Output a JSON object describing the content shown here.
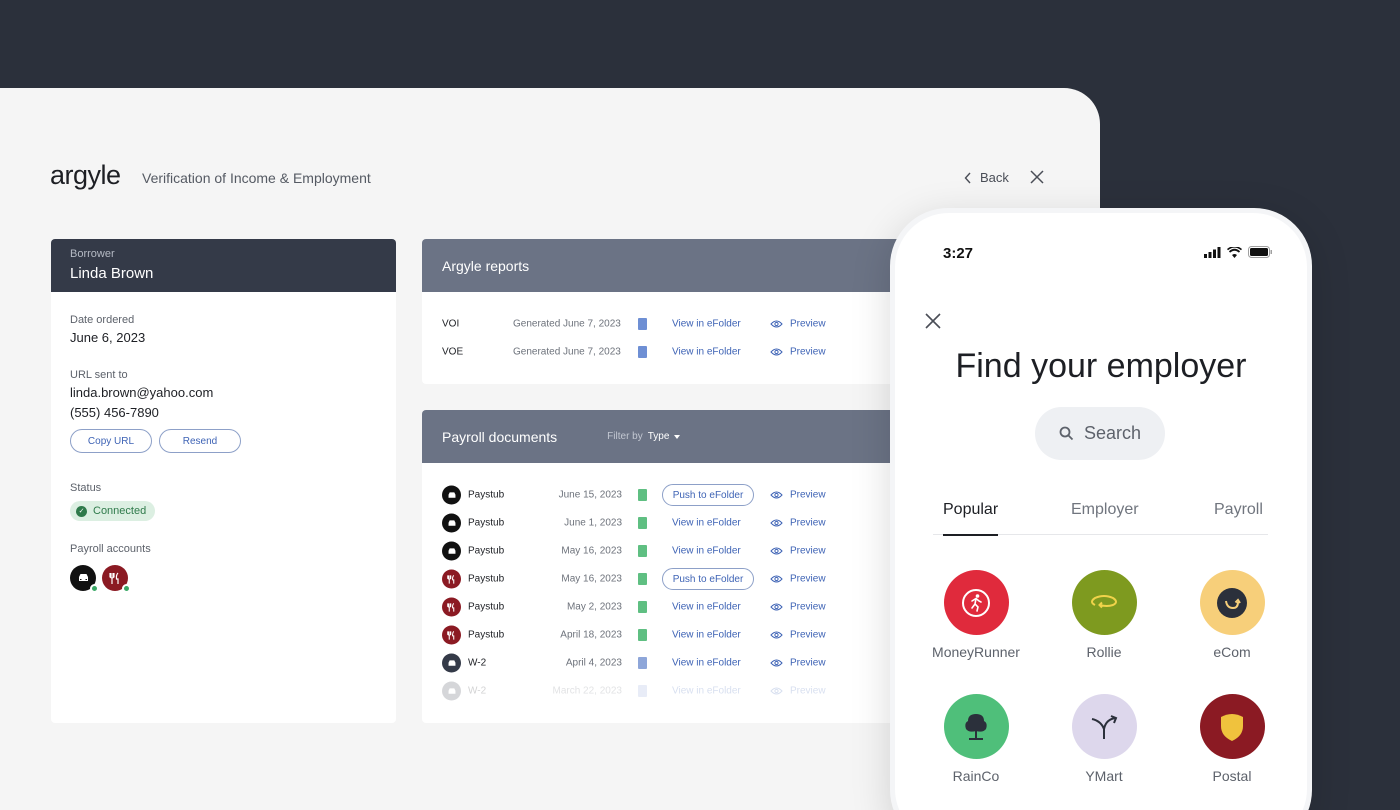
{
  "app": {
    "logo": "argyle",
    "title": "Verification of Income & Employment",
    "back_label": "Back"
  },
  "borrower": {
    "header_label": "Borrower",
    "name": "Linda Brown",
    "date_ordered_label": "Date ordered",
    "date_ordered": "June 6, 2023",
    "url_sent_label": "URL sent to",
    "email": "linda.brown@yahoo.com",
    "phone": "(555) 456-7890",
    "copy_url_label": "Copy URL",
    "resend_label": "Resend",
    "status_label": "Status",
    "status_value": "Connected",
    "payroll_accounts_label": "Payroll accounts"
  },
  "reports": {
    "title": "Argyle reports",
    "rows": [
      {
        "name": "VOI",
        "date": "Generated June 7, 2023",
        "link": "View in eFolder",
        "preview": "Preview"
      },
      {
        "name": "VOE",
        "date": "Generated June 7, 2023",
        "link": "View in eFolder",
        "preview": "Preview"
      }
    ]
  },
  "payroll": {
    "title": "Payroll documents",
    "filter_label": "Filter by",
    "filter_value": "Type",
    "rows": [
      {
        "name": "Paystub",
        "date": "June 15, 2023",
        "action": "Push to eFolder",
        "preview": "Preview"
      },
      {
        "name": "Paystub",
        "date": "June 1, 2023",
        "action": "View in eFolder",
        "preview": "Preview"
      },
      {
        "name": "Paystub",
        "date": "May 16, 2023",
        "action": "View in eFolder",
        "preview": "Preview"
      },
      {
        "name": "Paystub",
        "date": "May 16, 2023",
        "action": "Push to eFolder",
        "preview": "Preview"
      },
      {
        "name": "Paystub",
        "date": "May 2, 2023",
        "action": "View in eFolder",
        "preview": "Preview"
      },
      {
        "name": "Paystub",
        "date": "April 18, 2023",
        "action": "View in eFolder",
        "preview": "Preview"
      },
      {
        "name": "W-2",
        "date": "April 4, 2023",
        "action": "View in eFolder",
        "preview": "Preview"
      },
      {
        "name": "W-2",
        "date": "March 22, 2023",
        "action": "View in eFolder",
        "preview": "Preview"
      }
    ]
  },
  "phone": {
    "time": "3:27",
    "title": "Find your employer",
    "search_placeholder": "Search",
    "tabs": [
      "Popular",
      "Employer",
      "Payroll"
    ],
    "employers": [
      "MoneyRunner",
      "Rollie",
      "eCom",
      "RainCo",
      "YMart",
      "Postal"
    ]
  },
  "colors": {
    "accent": "#3e63b5",
    "header_dark": "#343a48",
    "panel_head": "#6b7385",
    "connected": "#2f7a4b"
  }
}
